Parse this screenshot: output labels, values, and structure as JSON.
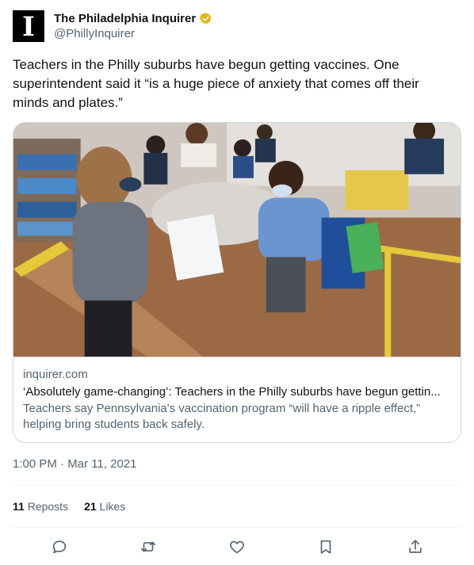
{
  "account": {
    "avatar_glyph": "I",
    "display_name": "The Philadelphia Inquirer",
    "handle": "@PhillyInquirer",
    "verified_color": "#e2b719"
  },
  "tweet": {
    "text": "Teachers in the Philly suburbs have begun getting vaccines. One superintendent said it “is a huge piece of anxiety that comes off their minds and plates.”",
    "timestamp": "1:00 PM · Mar 11, 2021"
  },
  "card": {
    "domain": "inquirer.com",
    "title": "‘Absolutely game-changing’: Teachers in the Philly suburbs have begun gettin...",
    "description": "Teachers say Pennsylvania's vaccination program “will have a ripple effect,” helping bring students back safely."
  },
  "stats": {
    "reposts_count": "11",
    "reposts_label": "Reposts",
    "likes_count": "21",
    "likes_label": "Likes"
  },
  "actions": [
    "reply-icon",
    "repost-icon",
    "like-icon",
    "bookmark-icon",
    "share-icon"
  ]
}
